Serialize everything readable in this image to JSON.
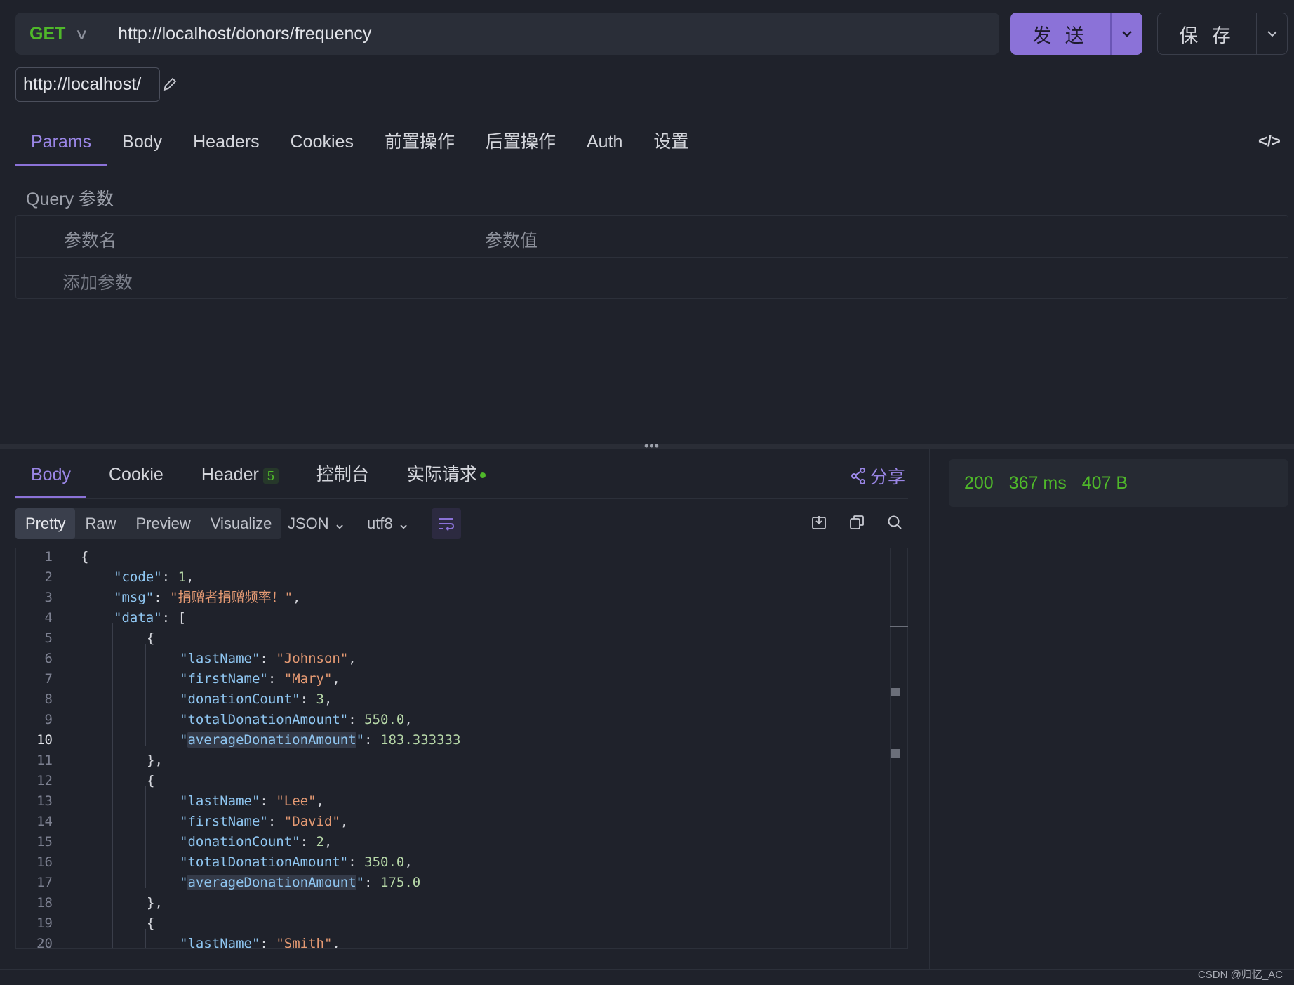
{
  "request": {
    "method": "GET",
    "url": "http://localhost/donors/frequency",
    "send_label": "发 送",
    "save_label": "保 存",
    "env_url": "http://localhost/"
  },
  "request_tabs": [
    "Params",
    "Body",
    "Headers",
    "Cookies",
    "前置操作",
    "后置操作",
    "Auth",
    "设置"
  ],
  "params": {
    "section_title": "Query 参数",
    "col_name": "参数名",
    "col_value": "参数值",
    "add_placeholder": "添加参数"
  },
  "response_tabs": {
    "body": "Body",
    "cookie": "Cookie",
    "header": "Header",
    "header_count": "5",
    "console": "控制台",
    "actual_request": "实际请求",
    "share": "分享"
  },
  "view_modes": [
    "Pretty",
    "Raw",
    "Preview",
    "Visualize"
  ],
  "format": "JSON",
  "encoding": "utf8",
  "status": {
    "code": "200",
    "time": "367 ms",
    "size": "407 B"
  },
  "code_lines": [
    "{",
    "\"code\": 1,",
    "\"msg\": \"捐赠者捐赠频率！\",",
    "\"data\": [",
    "{",
    "\"lastName\": \"Johnson\",",
    "\"firstName\": \"Mary\",",
    "\"donationCount\": 3,",
    "\"totalDonationAmount\": 550.0,",
    "\"averageDonationAmount\": 183.333333",
    "},",
    "{",
    "\"lastName\": \"Lee\",",
    "\"firstName\": \"David\",",
    "\"donationCount\": 2,",
    "\"totalDonationAmount\": 350.0,",
    "\"averageDonationAmount\": 175.0",
    "},",
    "{",
    "\"lastName\": \"Smith\","
  ],
  "current_line": 10,
  "watermark": "CSDN @归忆_AC",
  "colors": {
    "accent": "#8b72d8",
    "success": "#4fb82a",
    "json_key": "#8fc6f1",
    "json_string": "#e59a73",
    "json_number": "#b7d8a8"
  }
}
